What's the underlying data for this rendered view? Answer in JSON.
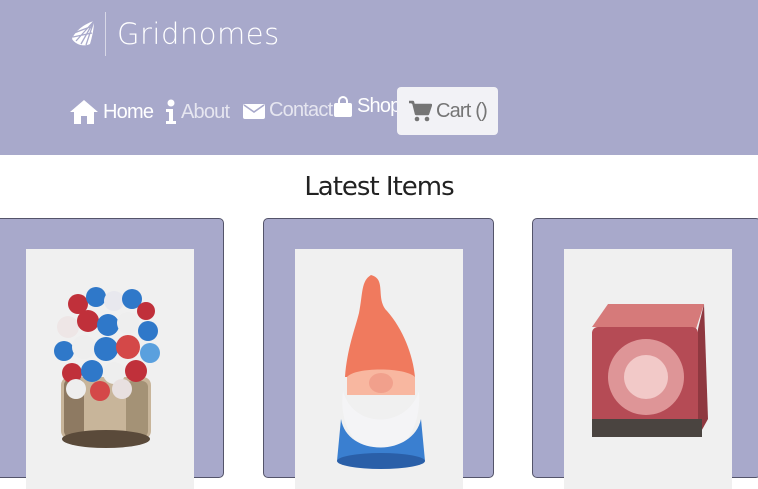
{
  "brand": {
    "name": "Gridnomes",
    "logo_icon": "butterfly-wing-icon"
  },
  "nav": {
    "items": [
      {
        "label": "Home",
        "icon": "home-icon"
      },
      {
        "label": "About",
        "icon": "info-icon"
      },
      {
        "label": "Contact",
        "icon": "envelope-icon"
      },
      {
        "label": "Shop",
        "icon": "shopping-bag-icon"
      },
      {
        "label": "Cart ()",
        "icon": "shopping-cart-icon"
      }
    ]
  },
  "main": {
    "title": "Latest Items"
  },
  "colors": {
    "header_bg": "#a8a9cb",
    "card_bg": "#a8a9cb",
    "cart_button_bg": "#f2f2f6"
  }
}
